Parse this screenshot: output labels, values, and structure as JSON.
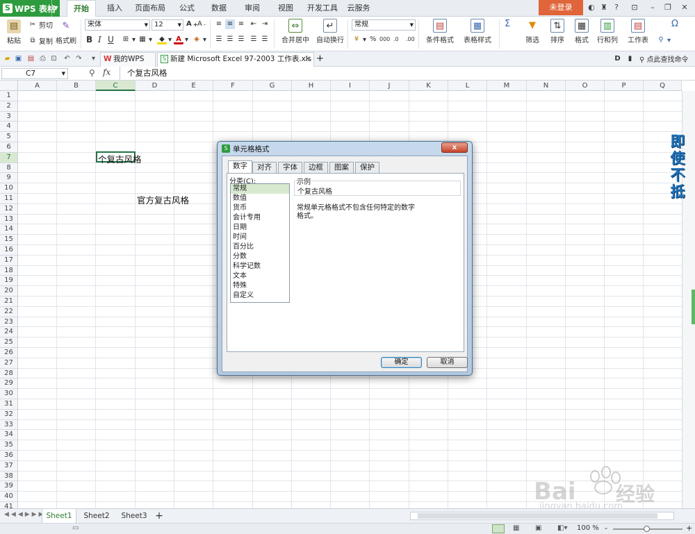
{
  "app": {
    "name": "WPS 表格",
    "logo": "S"
  },
  "menu_tabs": [
    "开始",
    "插入",
    "页面布局",
    "公式",
    "数据",
    "审阅",
    "视图",
    "开发工具",
    "云服务"
  ],
  "account": {
    "login_label": "未登录",
    "help_label": "?"
  },
  "ribbon": {
    "paste": "粘贴",
    "cut": "剪切",
    "copy": "复制",
    "format_painter": "格式刷",
    "font_name": "宋体",
    "font_size": "12",
    "merge_center": "合并居中",
    "wrap_text": "自动换行",
    "number_format": "常规",
    "conditional_format": "条件格式",
    "table_style": "表格样式",
    "sigma": "Σ",
    "filter": "筛选",
    "sort": "排序",
    "format": "格式",
    "rows_cols": "行和列",
    "worksheet": "工作表",
    "percent": "%",
    "comma": "000",
    "inc_dec": ".0",
    "dec_dec": ".00",
    "omega": "Ω"
  },
  "doc_tabs": {
    "home_tab": "我的WPS",
    "file_tab": "新建 Microsoft Excel 97-2003 工作表.xls",
    "add": "+",
    "search_cmd": "点此查找命令"
  },
  "formula_bar": {
    "name_box": "C7",
    "fx": "fx",
    "content": "个复古风格"
  },
  "columns": [
    "A",
    "B",
    "C",
    "D",
    "E",
    "F",
    "G",
    "H",
    "I",
    "J",
    "K",
    "L",
    "M",
    "N",
    "O",
    "P",
    "Q"
  ],
  "rows": [
    "1",
    "2",
    "3",
    "4",
    "5",
    "6",
    "7",
    "8",
    "9",
    "10",
    "11",
    "12",
    "13",
    "14",
    "15",
    "16",
    "17",
    "18",
    "19",
    "20",
    "21",
    "22",
    "23",
    "24",
    "25",
    "26",
    "27",
    "28",
    "29",
    "30",
    "31",
    "32",
    "33",
    "34",
    "35",
    "36",
    "37",
    "38",
    "39",
    "40",
    "41"
  ],
  "cells": {
    "c7": "个复古风格",
    "d11": "官方复古风格"
  },
  "dialog": {
    "title": "单元格格式",
    "close": "x",
    "tabs": [
      "数字",
      "对齐",
      "字体",
      "边框",
      "图案",
      "保护"
    ],
    "category_label": "分类(C):",
    "categories": [
      "常规",
      "数值",
      "货币",
      "会计专用",
      "日期",
      "时间",
      "百分比",
      "分数",
      "科学记数",
      "文本",
      "特殊",
      "自定义"
    ],
    "sample_label": "示例",
    "sample_value": "个复古风格",
    "description_line1": "常规单元格格式不包含任何特定的数字",
    "description_line2": "格式。",
    "ok": "确定",
    "cancel": "取消"
  },
  "sheets": [
    "Sheet1",
    "Sheet2",
    "Sheet3"
  ],
  "sheet_add": "+",
  "status": {
    "zoom": "100 %",
    "zoom_minus": "-",
    "zoom_plus": "+"
  },
  "side_note": [
    "即",
    "使",
    "不",
    "抵"
  ],
  "watermark": {
    "brand": "Bai",
    "brand2": "经验",
    "url": "jingyan.baidu.com"
  },
  "colors": {
    "wps_green": "#2e9b3e",
    "login_orange": "#e0653a",
    "selection_green": "#217346",
    "accent_blue": "#1e6fb6"
  }
}
